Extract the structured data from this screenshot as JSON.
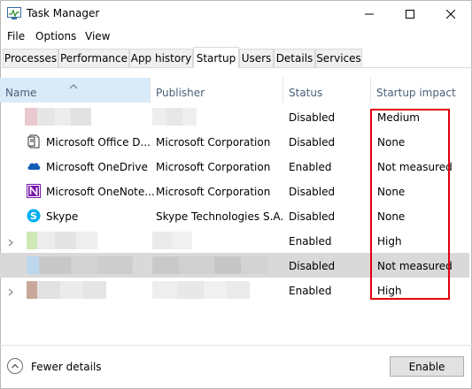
{
  "window": {
    "title": "Task Manager",
    "controls": [
      "minimize-icon",
      "maximize-icon",
      "close-icon"
    ]
  },
  "menu": [
    "File",
    "Options",
    "View"
  ],
  "tabs": [
    {
      "label": "Processes",
      "active": false
    },
    {
      "label": "Performance",
      "active": false
    },
    {
      "label": "App history",
      "active": false
    },
    {
      "label": "Startup",
      "active": true
    },
    {
      "label": "Users",
      "active": false
    },
    {
      "label": "Details",
      "active": false
    },
    {
      "label": "Services",
      "active": false
    }
  ],
  "columns": {
    "name": "Name",
    "publisher": "Publisher",
    "status": "Status",
    "impact": "Startup impact"
  },
  "rows": [
    {
      "name": "",
      "publisher": "",
      "status": "Disabled",
      "impact": "Medium",
      "icon": "blurred-icon",
      "expandable": false,
      "selected": false
    },
    {
      "name": "Microsoft Office D...",
      "publisher": "Microsoft Corporation",
      "status": "Disabled",
      "impact": "None",
      "icon": "office-document-icon",
      "expandable": false,
      "selected": false
    },
    {
      "name": "Microsoft OneDrive",
      "publisher": "Microsoft Corporation",
      "status": "Enabled",
      "impact": "Not measured",
      "icon": "onedrive-cloud-icon",
      "expandable": false,
      "selected": false
    },
    {
      "name": "Microsoft OneNote...",
      "publisher": "Microsoft Corporation",
      "status": "Disabled",
      "impact": "None",
      "icon": "onenote-icon",
      "expandable": false,
      "selected": false
    },
    {
      "name": "Skype",
      "publisher": "Skype Technologies S.A.",
      "status": "Disabled",
      "impact": "None",
      "icon": "skype-icon",
      "expandable": false,
      "selected": false
    },
    {
      "name": "",
      "publisher": "",
      "status": "Enabled",
      "impact": "High",
      "icon": "blurred-icon",
      "expandable": true,
      "selected": false
    },
    {
      "name": "",
      "publisher": "",
      "status": "Disabled",
      "impact": "Not measured",
      "icon": "blurred-icon",
      "expandable": false,
      "selected": true
    },
    {
      "name": "",
      "publisher": "",
      "status": "Enabled",
      "impact": "High",
      "icon": "blurred-icon",
      "expandable": true,
      "selected": false
    }
  ],
  "footer": {
    "fewer_details": "Fewer details",
    "enable": "Enable"
  },
  "colors": {
    "highlight": "#e3000f",
    "header_sort": "#d9ebf9",
    "selected_row": "#d9d9d9",
    "header_text": "#4c607a"
  }
}
